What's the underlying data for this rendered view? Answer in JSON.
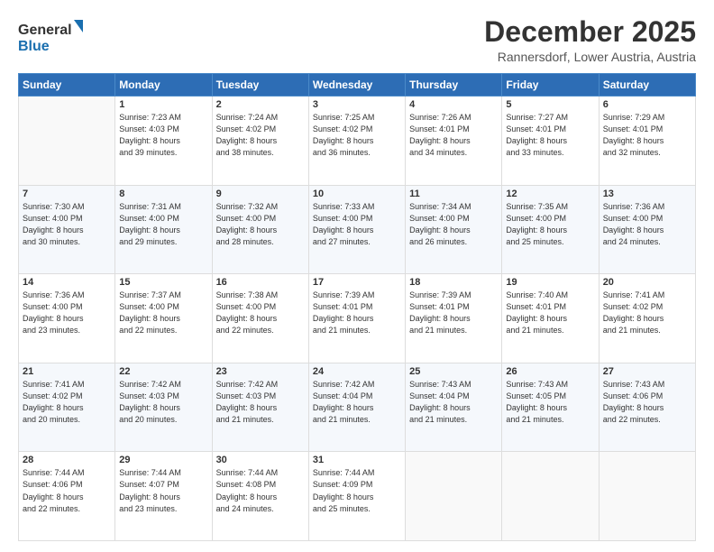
{
  "logo": {
    "line1": "General",
    "line2": "Blue"
  },
  "header": {
    "month": "December 2025",
    "location": "Rannersdorf, Lower Austria, Austria"
  },
  "days_of_week": [
    "Sunday",
    "Monday",
    "Tuesday",
    "Wednesday",
    "Thursday",
    "Friday",
    "Saturday"
  ],
  "weeks": [
    [
      {
        "day": "",
        "content": ""
      },
      {
        "day": "1",
        "content": "Sunrise: 7:23 AM\nSunset: 4:03 PM\nDaylight: 8 hours\nand 39 minutes."
      },
      {
        "day": "2",
        "content": "Sunrise: 7:24 AM\nSunset: 4:02 PM\nDaylight: 8 hours\nand 38 minutes."
      },
      {
        "day": "3",
        "content": "Sunrise: 7:25 AM\nSunset: 4:02 PM\nDaylight: 8 hours\nand 36 minutes."
      },
      {
        "day": "4",
        "content": "Sunrise: 7:26 AM\nSunset: 4:01 PM\nDaylight: 8 hours\nand 34 minutes."
      },
      {
        "day": "5",
        "content": "Sunrise: 7:27 AM\nSunset: 4:01 PM\nDaylight: 8 hours\nand 33 minutes."
      },
      {
        "day": "6",
        "content": "Sunrise: 7:29 AM\nSunset: 4:01 PM\nDaylight: 8 hours\nand 32 minutes."
      }
    ],
    [
      {
        "day": "7",
        "content": "Sunrise: 7:30 AM\nSunset: 4:00 PM\nDaylight: 8 hours\nand 30 minutes."
      },
      {
        "day": "8",
        "content": "Sunrise: 7:31 AM\nSunset: 4:00 PM\nDaylight: 8 hours\nand 29 minutes."
      },
      {
        "day": "9",
        "content": "Sunrise: 7:32 AM\nSunset: 4:00 PM\nDaylight: 8 hours\nand 28 minutes."
      },
      {
        "day": "10",
        "content": "Sunrise: 7:33 AM\nSunset: 4:00 PM\nDaylight: 8 hours\nand 27 minutes."
      },
      {
        "day": "11",
        "content": "Sunrise: 7:34 AM\nSunset: 4:00 PM\nDaylight: 8 hours\nand 26 minutes."
      },
      {
        "day": "12",
        "content": "Sunrise: 7:35 AM\nSunset: 4:00 PM\nDaylight: 8 hours\nand 25 minutes."
      },
      {
        "day": "13",
        "content": "Sunrise: 7:36 AM\nSunset: 4:00 PM\nDaylight: 8 hours\nand 24 minutes."
      }
    ],
    [
      {
        "day": "14",
        "content": "Sunrise: 7:36 AM\nSunset: 4:00 PM\nDaylight: 8 hours\nand 23 minutes."
      },
      {
        "day": "15",
        "content": "Sunrise: 7:37 AM\nSunset: 4:00 PM\nDaylight: 8 hours\nand 22 minutes."
      },
      {
        "day": "16",
        "content": "Sunrise: 7:38 AM\nSunset: 4:00 PM\nDaylight: 8 hours\nand 22 minutes."
      },
      {
        "day": "17",
        "content": "Sunrise: 7:39 AM\nSunset: 4:01 PM\nDaylight: 8 hours\nand 21 minutes."
      },
      {
        "day": "18",
        "content": "Sunrise: 7:39 AM\nSunset: 4:01 PM\nDaylight: 8 hours\nand 21 minutes."
      },
      {
        "day": "19",
        "content": "Sunrise: 7:40 AM\nSunset: 4:01 PM\nDaylight: 8 hours\nand 21 minutes."
      },
      {
        "day": "20",
        "content": "Sunrise: 7:41 AM\nSunset: 4:02 PM\nDaylight: 8 hours\nand 21 minutes."
      }
    ],
    [
      {
        "day": "21",
        "content": "Sunrise: 7:41 AM\nSunset: 4:02 PM\nDaylight: 8 hours\nand 20 minutes."
      },
      {
        "day": "22",
        "content": "Sunrise: 7:42 AM\nSunset: 4:03 PM\nDaylight: 8 hours\nand 20 minutes."
      },
      {
        "day": "23",
        "content": "Sunrise: 7:42 AM\nSunset: 4:03 PM\nDaylight: 8 hours\nand 21 minutes."
      },
      {
        "day": "24",
        "content": "Sunrise: 7:42 AM\nSunset: 4:04 PM\nDaylight: 8 hours\nand 21 minutes."
      },
      {
        "day": "25",
        "content": "Sunrise: 7:43 AM\nSunset: 4:04 PM\nDaylight: 8 hours\nand 21 minutes."
      },
      {
        "day": "26",
        "content": "Sunrise: 7:43 AM\nSunset: 4:05 PM\nDaylight: 8 hours\nand 21 minutes."
      },
      {
        "day": "27",
        "content": "Sunrise: 7:43 AM\nSunset: 4:06 PM\nDaylight: 8 hours\nand 22 minutes."
      }
    ],
    [
      {
        "day": "28",
        "content": "Sunrise: 7:44 AM\nSunset: 4:06 PM\nDaylight: 8 hours\nand 22 minutes."
      },
      {
        "day": "29",
        "content": "Sunrise: 7:44 AM\nSunset: 4:07 PM\nDaylight: 8 hours\nand 23 minutes."
      },
      {
        "day": "30",
        "content": "Sunrise: 7:44 AM\nSunset: 4:08 PM\nDaylight: 8 hours\nand 24 minutes."
      },
      {
        "day": "31",
        "content": "Sunrise: 7:44 AM\nSunset: 4:09 PM\nDaylight: 8 hours\nand 25 minutes."
      },
      {
        "day": "",
        "content": ""
      },
      {
        "day": "",
        "content": ""
      },
      {
        "day": "",
        "content": ""
      }
    ]
  ]
}
